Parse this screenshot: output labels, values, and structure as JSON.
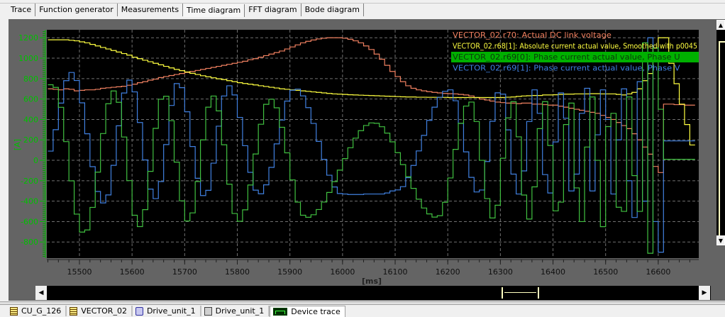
{
  "tabs": [
    {
      "label": "Trace",
      "active": false
    },
    {
      "label": "Function generator",
      "active": false
    },
    {
      "label": "Measurements",
      "active": false
    },
    {
      "label": "Time diagram",
      "active": true
    },
    {
      "label": "FFT diagram",
      "active": false
    },
    {
      "label": "Bode diagram",
      "active": false
    }
  ],
  "bottom_tabs": [
    {
      "label": "CU_G_126",
      "icon": "document-icon",
      "active": false
    },
    {
      "label": "VECTOR_02",
      "icon": "document-icon",
      "active": false
    },
    {
      "label": "Drive_unit_1",
      "icon": "drive-icon",
      "active": false
    },
    {
      "label": "Drive_unit_1",
      "icon": "drive-unit-icon",
      "active": false
    },
    {
      "label": "Device trace",
      "icon": "trace-icon",
      "active": true
    }
  ],
  "scroll_icons": {
    "up": "▲",
    "down": "▼",
    "left": "◀",
    "right": "▶"
  },
  "colors": {
    "background": "#000000",
    "panel": "#646464",
    "axis": "#00c000",
    "dc_link": "#f08060",
    "abs_current": "#ffff40",
    "phase_u": "#40c040",
    "phase_v": "#4080e0",
    "legend_highlight": "#00b000"
  },
  "chart_data": {
    "type": "line",
    "ylabel": "[A]",
    "xlabel": "[ms]",
    "xlim": [
      15438,
      16677
    ],
    "ylim": [
      -958,
      1278
    ],
    "grid": true,
    "legend_placement": "top-right",
    "x_ticks": [
      15500,
      15600,
      15700,
      15800,
      15900,
      16000,
      16100,
      16200,
      16300,
      16400,
      16500,
      16600
    ],
    "y_ticks": [
      1200,
      1000,
      800,
      600,
      400,
      200,
      0,
      -200,
      -400,
      -600,
      -800
    ],
    "x_start": 15440,
    "x_step": 10,
    "series": [
      {
        "name": "VECTOR_02.r70: Actual DC link voltage",
        "color": "#f08060",
        "highlighted": false,
        "values": [
          700,
          695,
          690,
          700,
          695,
          680,
          685,
          690,
          690,
          695,
          705,
          710,
          715,
          720,
          725,
          735,
          745,
          760,
          770,
          785,
          795,
          810,
          820,
          830,
          840,
          850,
          860,
          870,
          880,
          890,
          900,
          910,
          920,
          930,
          940,
          950,
          960,
          970,
          985,
          995,
          1010,
          1025,
          1040,
          1055,
          1070,
          1090,
          1110,
          1130,
          1150,
          1165,
          1178,
          1188,
          1195,
          1200,
          1200,
          1200,
          1195,
          1185,
          1170,
          1150,
          1120,
          1085,
          1040,
          990,
          930,
          870,
          820,
          770,
          730,
          705,
          690,
          680,
          672,
          665,
          660,
          655,
          652,
          650,
          645,
          640,
          630,
          615,
          600,
          590,
          580,
          570,
          565,
          560,
          560,
          555,
          560,
          560,
          550,
          550,
          545,
          540,
          540,
          530,
          520,
          510,
          500,
          490,
          480,
          470,
          460,
          440,
          420,
          400,
          370,
          340,
          310,
          260,
          200,
          130,
          60,
          -60,
          -120,
          550,
          550,
          545,
          545,
          540,
          540
        ]
      },
      {
        "name": "VECTOR_02.r68[1]: Absolute current actual value, Smoothed with p0045",
        "color": "#ffff40",
        "highlighted": false,
        "values": [
          1180,
          1180,
          1180,
          1180,
          1175,
          1170,
          1160,
          1150,
          1135,
          1120,
          1105,
          1090,
          1075,
          1060,
          1045,
          1030,
          1010,
          995,
          980,
          965,
          950,
          935,
          920,
          905,
          890,
          878,
          865,
          852,
          840,
          828,
          818,
          808,
          798,
          790,
          780,
          770,
          760,
          752,
          745,
          738,
          730,
          723,
          715,
          708,
          700,
          695,
          690,
          685,
          680,
          675,
          670,
          665,
          660,
          655,
          650,
          648,
          645,
          642,
          640,
          638,
          636,
          634,
          632,
          630,
          628,
          626,
          624,
          622,
          620,
          620,
          618,
          618,
          617,
          617,
          616,
          616,
          615,
          615,
          615,
          615,
          615,
          615,
          615,
          615,
          615,
          615,
          615,
          618,
          620,
          625,
          630,
          632,
          635,
          635,
          640,
          640,
          642,
          645,
          648,
          648,
          650,
          650,
          650,
          652,
          652,
          650,
          650,
          650,
          645,
          640,
          650,
          665,
          700,
          780,
          850,
          1100,
          1200,
          1200,
          950,
          750,
          550,
          350,
          150
        ]
      },
      {
        "name": "VECTOR_02.r69[0]: Phase current actual value, Phase U",
        "color": "#40c040",
        "highlighted": true,
        "values": [
          740,
          714,
          519,
          183,
          -201,
          -527,
          -703,
          -682,
          -461,
          -116,
          262,
          554,
          679,
          568,
          228,
          -199,
          -538,
          -649,
          -483,
          -108,
          313,
          598,
          627,
          388,
          -18,
          -397,
          -594,
          -515,
          -208,
          200,
          520,
          629,
          484,
          152,
          -234,
          -521,
          -597,
          -485,
          -242,
          62,
          353,
          548,
          598,
          514,
          323,
          73,
          -192,
          -410,
          -538,
          -558,
          -533,
          -482,
          -409,
          -315,
          -209,
          -96,
          17,
          123,
          217,
          290,
          341,
          366,
          362,
          329,
          266,
          181,
          75,
          -42,
          -161,
          -275,
          -381,
          -467,
          -525,
          -556,
          -542,
          -411,
          -173,
          107,
          362,
          531,
          570,
          380,
          0,
          -375,
          -565,
          -440,
          20,
          415,
          575,
          230,
          -340,
          -575,
          -260,
          310,
          575,
          145,
          -495,
          -410,
          350,
          560,
          -270,
          -600,
          130,
          620,
          0,
          -650,
          330,
          460,
          -460,
          -500,
          620,
          -150,
          -500,
          1150,
          -910,
          1100,
          500,
          10,
          10,
          10,
          10,
          10,
          10
        ]
      },
      {
        "name": "VECTOR_02.r69[1]: Phase current actual value, Phase V",
        "color": "#4080e0",
        "highlighted": false,
        "values": [
          90,
          300,
          560,
          780,
          860,
          781,
          563,
          260,
          -62,
          -305,
          -417,
          -339,
          -49,
          338,
          659,
          785,
          670,
          370,
          4,
          -282,
          -375,
          -208,
          154,
          537,
          751,
          711,
          475,
          135,
          -176,
          -345,
          -294,
          -28,
          334,
          630,
          730,
          640,
          420,
          143,
          -118,
          -292,
          -328,
          -240,
          -69,
          161,
          394,
          580,
          686,
          697,
          631,
          516,
          361,
          185,
          9,
          -146,
          -261,
          -325,
          -330,
          -335,
          -335,
          -335,
          -330,
          -330,
          -330,
          -330,
          -320,
          -300,
          -290,
          -258,
          -170,
          -50,
          92,
          244,
          391,
          520,
          617,
          675,
          690,
          583,
          361,
          83,
          -167,
          -310,
          -291,
          -12,
          382,
          661,
          648,
          298,
          -135,
          -330,
          -104,
          380,
          690,
          460,
          -140,
          -320,
          180,
          660,
          412,
          -300,
          -135,
          460,
          705,
          -300,
          250,
          690,
          400,
          -330,
          200,
          700,
          -200,
          -560,
          770,
          -400,
          1200,
          -600,
          -900,
          190,
          190,
          190,
          190,
          190,
          190
        ]
      }
    ]
  }
}
